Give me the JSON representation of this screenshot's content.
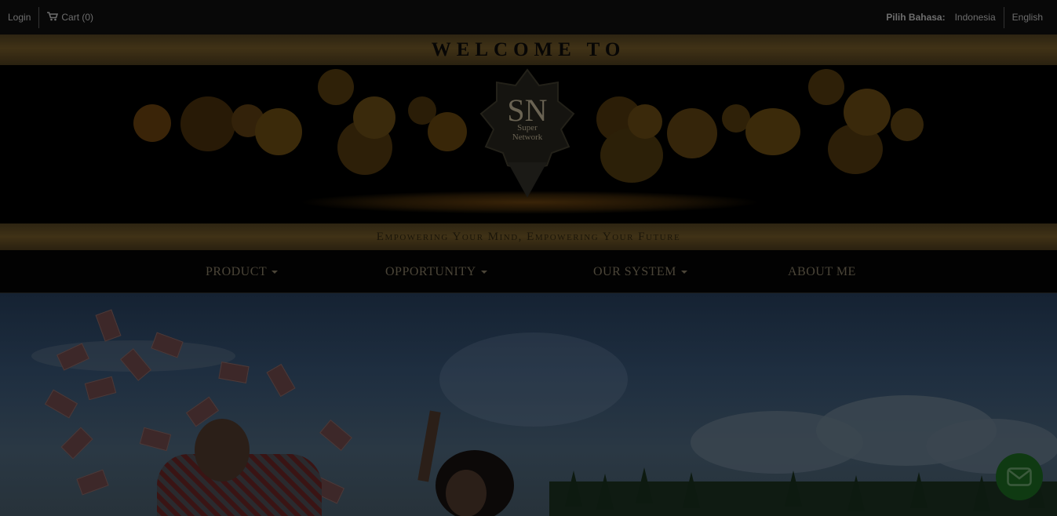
{
  "topbar": {
    "login": "Login",
    "cart": "Cart (0)",
    "lang_label": "Pilih Bahasa:",
    "languages": [
      "Indonesia",
      "English"
    ]
  },
  "banner": {
    "welcome": "WELCOME TO",
    "logo_initials": "SN",
    "logo_line1": "Super",
    "logo_line2": "Network",
    "tagline": "Empowering Your Mind, Empowering Your Future"
  },
  "nav": {
    "items": [
      {
        "label": "PRODUCT",
        "has_dropdown": true
      },
      {
        "label": "OPPORTUNITY",
        "has_dropdown": true
      },
      {
        "label": "OUR SYSTEM",
        "has_dropdown": true
      },
      {
        "label": "ABOUT ME",
        "has_dropdown": false
      }
    ]
  },
  "icons": {
    "cart": "shopping-cart-icon",
    "chat": "envelope-icon"
  },
  "colors": {
    "gold_band": "#403216",
    "chat_button": "#0f3a12"
  }
}
